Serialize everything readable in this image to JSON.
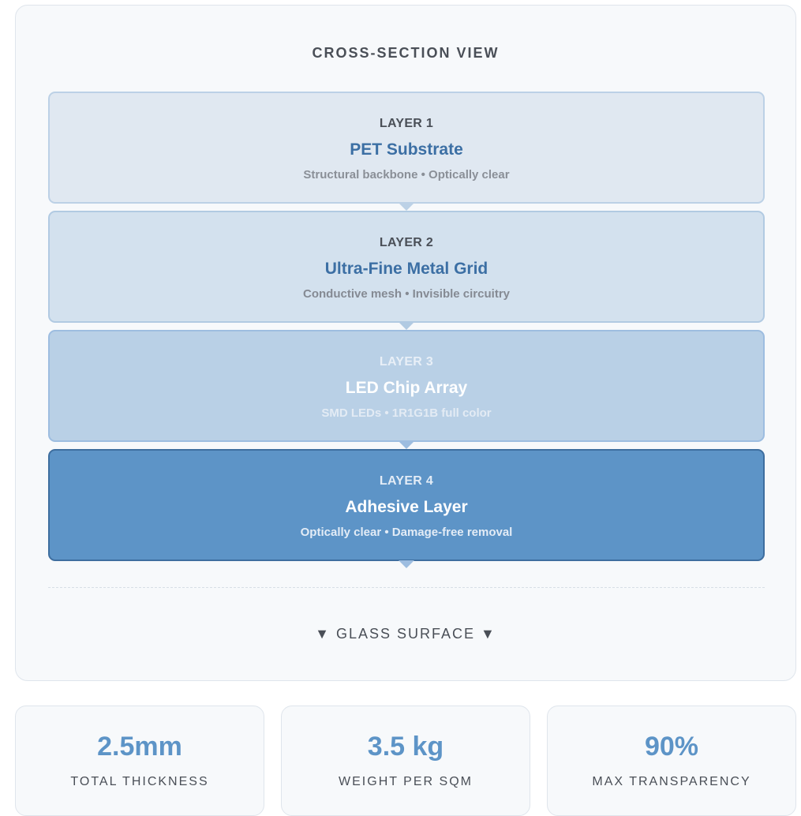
{
  "diagram": {
    "title": "CROSS-SECTION VIEW",
    "layers": [
      {
        "number": "LAYER 1",
        "name": "PET Substrate",
        "description": "Structural backbone • Optically clear"
      },
      {
        "number": "LAYER 2",
        "name": "Ultra-Fine Metal Grid",
        "description": "Conductive mesh • Invisible circuitry"
      },
      {
        "number": "LAYER 3",
        "name": "LED Chip Array",
        "description": "SMD LEDs • 1R1G1B full color"
      },
      {
        "number": "LAYER 4",
        "name": "Adhesive Layer",
        "description": "Optically clear • Damage-free removal"
      }
    ],
    "base_label": "▼ GLASS SURFACE ▼"
  },
  "stats": [
    {
      "value": "2.5mm",
      "label": "TOTAL THICKNESS"
    },
    {
      "value": "3.5 kg",
      "label": "WEIGHT PER SQM"
    },
    {
      "value": "90%",
      "label": "MAX TRANSPARENCY"
    }
  ],
  "colors": {
    "accent": "#5d94c7",
    "title_text": "#3c6fa4",
    "layer1_bg": "#e0e8f1",
    "layer2_bg": "#d3e1ee",
    "layer3_bg": "#b9d0e6",
    "layer4_bg": "#5d94c7"
  }
}
